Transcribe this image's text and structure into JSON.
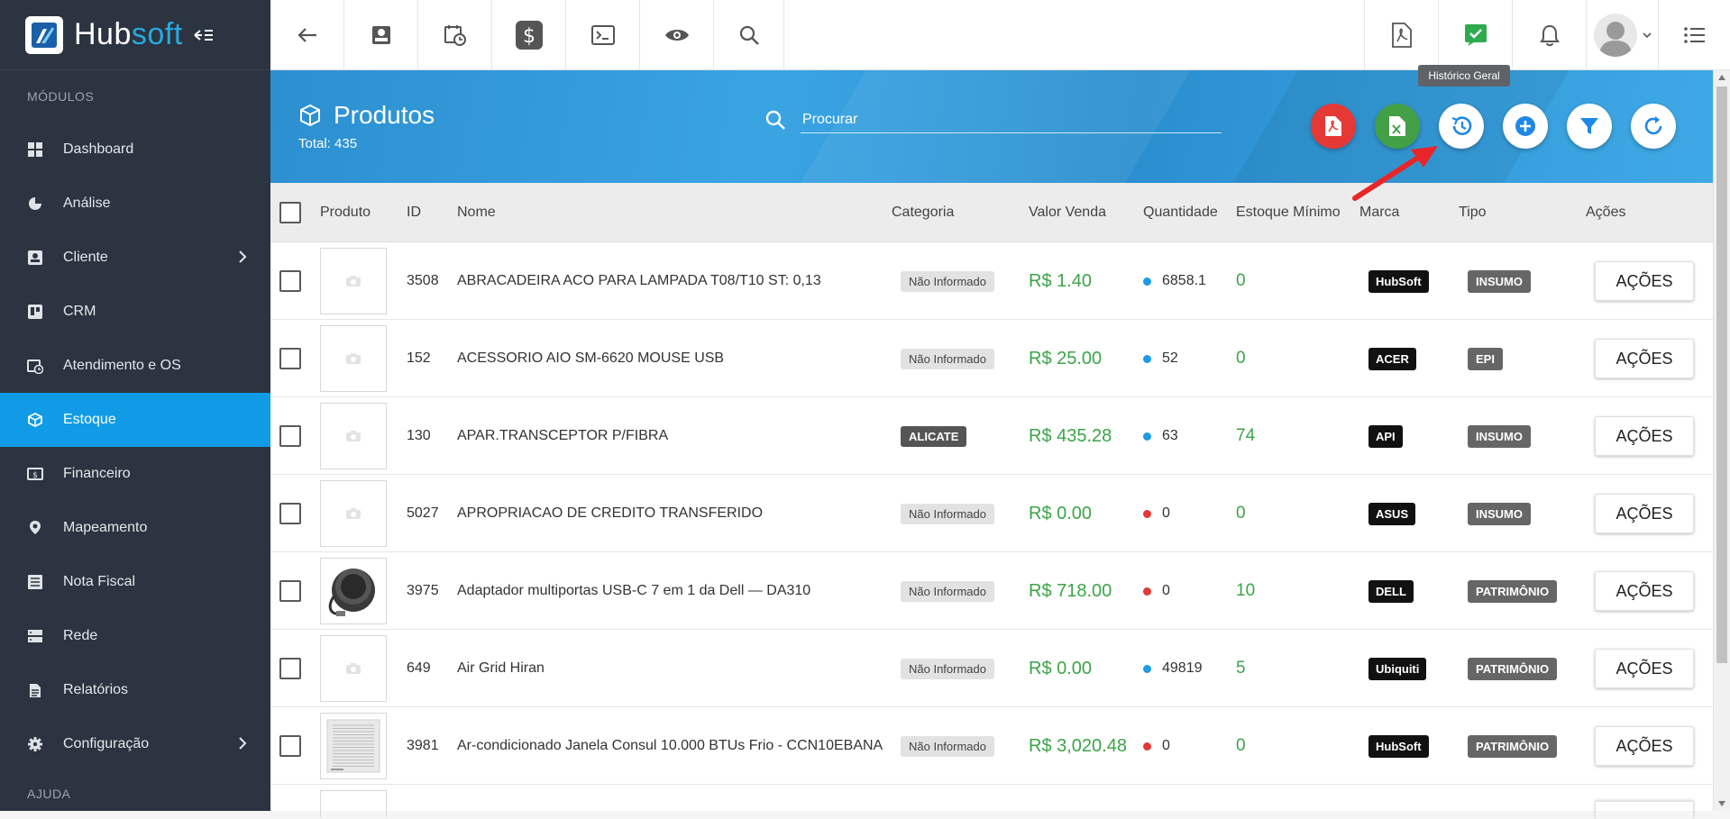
{
  "brand": {
    "name_part1": "Hub",
    "name_part2": "soft"
  },
  "sidebar": {
    "section_modules": "MÓDULOS",
    "section_help": "AJUDA",
    "items": [
      {
        "label": "Dashboard",
        "icon": "dashboard-icon"
      },
      {
        "label": "Análise",
        "icon": "pie-chart-icon"
      },
      {
        "label": "Cliente",
        "icon": "contact-card-icon"
      },
      {
        "label": "CRM",
        "icon": "trello-board-icon"
      },
      {
        "label": "Atendimento e OS",
        "icon": "calendar-clock-icon"
      },
      {
        "label": "Estoque",
        "icon": "box-icon"
      },
      {
        "label": "Financeiro",
        "icon": "money-icon"
      },
      {
        "label": "Mapeamento",
        "icon": "map-pin-icon"
      },
      {
        "label": "Nota Fiscal",
        "icon": "document-list-icon"
      },
      {
        "label": "Rede",
        "icon": "server-icon"
      },
      {
        "label": "Relatórios",
        "icon": "file-report-icon"
      },
      {
        "label": "Configuração",
        "icon": "gear-icon"
      }
    ]
  },
  "tooltip": "Histórico Geral",
  "header": {
    "title": "Produtos",
    "total": "Total: 435",
    "search_placeholder": "Procurar"
  },
  "colors": {
    "accent": "#119be6",
    "band": "#2e93d4",
    "pdf": "#e53935",
    "excel": "#43a047",
    "price": "#3aa547"
  },
  "table": {
    "headers": {
      "produto": "Produto",
      "id": "ID",
      "nome": "Nome",
      "categoria": "Categoria",
      "valor": "Valor Venda",
      "quantidade": "Quantidade",
      "estoque_minimo": "Estoque Mínimo",
      "marca": "Marca",
      "tipo": "Tipo",
      "acoes": "Ações"
    },
    "action_label": "AÇÕES",
    "rows": [
      {
        "id": "3508",
        "nome": "ABRACADEIRA ACO PARA LAMPADA T08/T10 ST: 0,13",
        "categoria": "Não Informado",
        "valor": "R$ 1.40",
        "quantidade": "6858.1",
        "estoque_minimo": "0",
        "marca": "HubSoft",
        "tipo": "INSUMO",
        "stock_status": "ok"
      },
      {
        "id": "152",
        "nome": "ACESSORIO AIO SM-6620 MOUSE USB",
        "categoria": "Não Informado",
        "valor": "R$ 25.00",
        "quantidade": "52",
        "estoque_minimo": "0",
        "marca": "ACER",
        "tipo": "EPI",
        "stock_status": "ok"
      },
      {
        "id": "130",
        "nome": "APAR.TRANSCEPTOR P/FIBRA",
        "categoria": "ALICATE",
        "valor": "R$ 435.28",
        "quantidade": "63",
        "estoque_minimo": "74",
        "marca": "API",
        "tipo": "INSUMO",
        "stock_status": "ok"
      },
      {
        "id": "5027",
        "nome": "APROPRIACAO DE CREDITO TRANSFERIDO",
        "categoria": "Não Informado",
        "valor": "R$ 0.00",
        "quantidade": "0",
        "estoque_minimo": "0",
        "marca": "ASUS",
        "tipo": "INSUMO",
        "stock_status": "empty"
      },
      {
        "id": "3975",
        "nome": "Adaptador multiportas USB-C 7 em 1 da Dell — DA310",
        "categoria": "Não Informado",
        "valor": "R$ 718.00",
        "quantidade": "0",
        "estoque_minimo": "10",
        "marca": "DELL",
        "tipo": "PATRIMÔNIO",
        "stock_status": "empty"
      },
      {
        "id": "649",
        "nome": "Air Grid Hiran",
        "categoria": "Não Informado",
        "valor": "R$ 0.00",
        "quantidade": "49819",
        "estoque_minimo": "5",
        "marca": "Ubiquiti",
        "tipo": "PATRIMÔNIO",
        "stock_status": "ok"
      },
      {
        "id": "3981",
        "nome": "Ar-condicionado Janela Consul 10.000 BTUs Frio - CCN10EBANA",
        "categoria": "Não Informado",
        "valor": "R$ 3,020.48",
        "quantidade": "0",
        "estoque_minimo": "0",
        "marca": "HubSoft",
        "tipo": "PATRIMÔNIO",
        "stock_status": "empty"
      }
    ]
  }
}
